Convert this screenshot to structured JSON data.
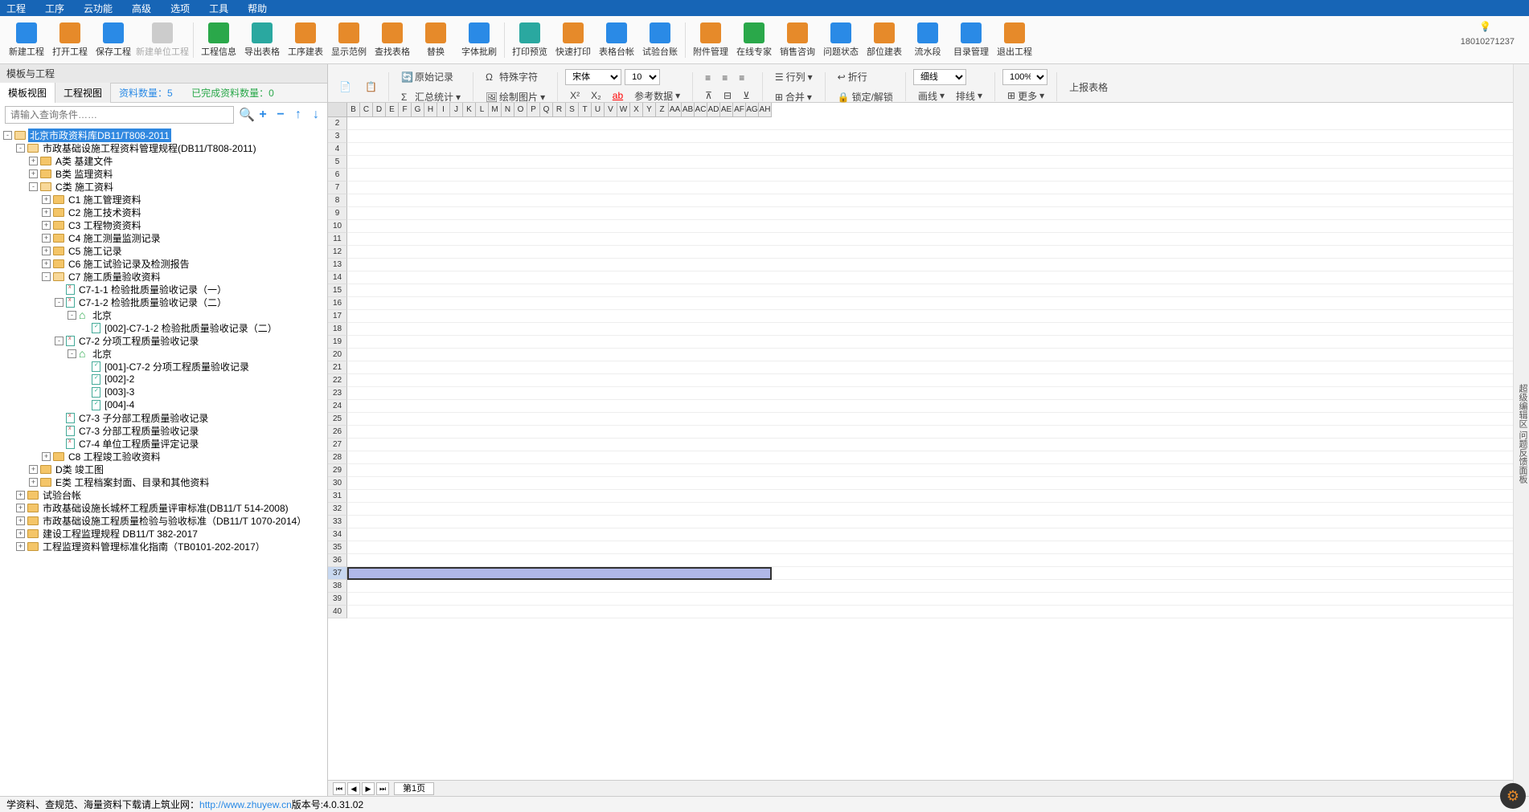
{
  "menu": [
    "工程",
    "工序",
    "云功能",
    "高级",
    "选项",
    "工具",
    "帮助"
  ],
  "toolbar": [
    {
      "label": "新建工程",
      "color": "ic-blue"
    },
    {
      "label": "打开工程",
      "color": "ic-orange"
    },
    {
      "label": "保存工程",
      "color": "ic-blue"
    },
    {
      "label": "新建单位工程",
      "color": "ic-gray",
      "disabled": true,
      "sep": true
    },
    {
      "label": "工程信息",
      "color": "ic-green"
    },
    {
      "label": "导出表格",
      "color": "ic-teal"
    },
    {
      "label": "工序建表",
      "color": "ic-orange"
    },
    {
      "label": "显示范例",
      "color": "ic-orange"
    },
    {
      "label": "查找表格",
      "color": "ic-orange"
    },
    {
      "label": "替换",
      "color": "ic-orange"
    },
    {
      "label": "字体批刷",
      "color": "ic-blue",
      "sep": true
    },
    {
      "label": "打印预览",
      "color": "ic-teal"
    },
    {
      "label": "快速打印",
      "color": "ic-orange"
    },
    {
      "label": "表格台帐",
      "color": "ic-blue"
    },
    {
      "label": "试验台账",
      "color": "ic-blue",
      "sep": true
    },
    {
      "label": "附件管理",
      "color": "ic-orange"
    },
    {
      "label": "在线专家",
      "color": "ic-green"
    },
    {
      "label": "销售咨询",
      "color": "ic-orange"
    },
    {
      "label": "问题状态",
      "color": "ic-blue"
    },
    {
      "label": "部位建表",
      "color": "ic-orange"
    },
    {
      "label": "流水段",
      "color": "ic-blue"
    },
    {
      "label": "目录管理",
      "color": "ic-blue"
    },
    {
      "label": "退出工程",
      "color": "ic-orange"
    }
  ],
  "userNum": "18010271237",
  "leftPanel": {
    "title": "模板与工程",
    "tab1": "模板视图",
    "tab2": "工程视图",
    "info1": "资料数量：5",
    "info2": "已完成资料数量：0",
    "searchPlaceholder": "请输入查询条件……"
  },
  "tree": [
    {
      "d": 0,
      "t": "-",
      "i": "fo",
      "l": "北京市政资料库DB11/T808-2011",
      "sel": true
    },
    {
      "d": 1,
      "t": "-",
      "i": "fo",
      "l": "市政基础设施工程资料管理规程(DB11/T808-2011)"
    },
    {
      "d": 2,
      "t": "+",
      "i": "f",
      "l": "A类 基建文件"
    },
    {
      "d": 2,
      "t": "+",
      "i": "f",
      "l": "B类 监理资料"
    },
    {
      "d": 2,
      "t": "-",
      "i": "fo",
      "l": "C类 施工资料"
    },
    {
      "d": 3,
      "t": "+",
      "i": "f",
      "l": "C1 施工管理资料"
    },
    {
      "d": 3,
      "t": "+",
      "i": "f",
      "l": "C2 施工技术资料"
    },
    {
      "d": 3,
      "t": "+",
      "i": "f",
      "l": "C3 工程物资资料"
    },
    {
      "d": 3,
      "t": "+",
      "i": "f",
      "l": "C4 施工测量监测记录"
    },
    {
      "d": 3,
      "t": "+",
      "i": "f",
      "l": "C5 施工记录"
    },
    {
      "d": 3,
      "t": "+",
      "i": "f",
      "l": "C6 施工试验记录及检测报告"
    },
    {
      "d": 3,
      "t": "-",
      "i": "fo",
      "l": "C7 施工质量验收资料"
    },
    {
      "d": 4,
      "t": " ",
      "i": "d",
      "l": "C7-1-1 检验批质量验收记录（一）"
    },
    {
      "d": 4,
      "t": "-",
      "i": "d",
      "l": "C7-1-2 检验批质量验收记录（二）"
    },
    {
      "d": 5,
      "t": "-",
      "i": "h",
      "l": "北京"
    },
    {
      "d": 6,
      "t": " ",
      "i": "dg",
      "l": "[002]-C7-1-2 检验批质量验收记录（二）"
    },
    {
      "d": 4,
      "t": "-",
      "i": "d",
      "l": "C7-2 分项工程质量验收记录"
    },
    {
      "d": 5,
      "t": "-",
      "i": "h",
      "l": "北京"
    },
    {
      "d": 6,
      "t": " ",
      "i": "dg",
      "l": "[001]-C7-2 分项工程质量验收记录"
    },
    {
      "d": 6,
      "t": " ",
      "i": "dg",
      "l": "[002]-2"
    },
    {
      "d": 6,
      "t": " ",
      "i": "dg",
      "l": "[003]-3"
    },
    {
      "d": 6,
      "t": " ",
      "i": "dg",
      "l": "[004]-4"
    },
    {
      "d": 4,
      "t": " ",
      "i": "d",
      "l": "C7-3 子分部工程质量验收记录"
    },
    {
      "d": 4,
      "t": " ",
      "i": "d",
      "l": "C7-3 分部工程质量验收记录"
    },
    {
      "d": 4,
      "t": " ",
      "i": "d",
      "l": "C7-4 单位工程质量评定记录"
    },
    {
      "d": 3,
      "t": "+",
      "i": "f",
      "l": "C8 工程竣工验收资料"
    },
    {
      "d": 2,
      "t": "+",
      "i": "f",
      "l": "D类 竣工图"
    },
    {
      "d": 2,
      "t": "+",
      "i": "f",
      "l": "E类 工程档案封面、目录和其他资料"
    },
    {
      "d": 1,
      "t": "+",
      "i": "f",
      "l": "试验台帐"
    },
    {
      "d": 1,
      "t": "+",
      "i": "f",
      "l": "市政基础设施长城杯工程质量评审标准(DB11/T 514-2008)"
    },
    {
      "d": 1,
      "t": "+",
      "i": "f",
      "l": "市政基础设施工程质量检验与验收标准（DB11/T 1070-2014）"
    },
    {
      "d": 1,
      "t": "+",
      "i": "f",
      "l": "建设工程监理规程 DB11/T 382-2017"
    },
    {
      "d": 1,
      "t": "+",
      "i": "f",
      "l": "工程监理资料管理标准化指南（TB0101-202-2017）"
    }
  ],
  "ribbon": {
    "r1": "原始记录",
    "r2": "汇总统计",
    "r3": "特殊字符",
    "r4": "绘制图片",
    "r5": "参考数据",
    "r6": "行列",
    "r7": "合并",
    "r8": "折行",
    "r9": "锁定/解锁",
    "r10": "画线",
    "r11": "排线",
    "r12": "更多",
    "r13": "上报表格",
    "font": "宋体",
    "size": "10",
    "line": "细线",
    "zoom": "100%"
  },
  "cols": [
    "B",
    "C",
    "D",
    "E",
    "F",
    "G",
    "H",
    "I",
    "J",
    "K",
    "L",
    "M",
    "N",
    "O",
    "P",
    "Q",
    "R",
    "S",
    "T",
    "U",
    "V",
    "W",
    "X",
    "Y",
    "Z",
    "AA",
    "AB",
    "AC",
    "AD",
    "AE",
    "AF",
    "AG",
    "AH"
  ],
  "selectedRow": 37,
  "pager": "第1页",
  "status": {
    "text1": "学资料、查规范、海量资料下载请上筑业网：",
    "url": "http://www.zhuyew.cn",
    "text2": " 版本号:4.0.31.02"
  },
  "sideText": "超级编辑区 问题反馈面板"
}
